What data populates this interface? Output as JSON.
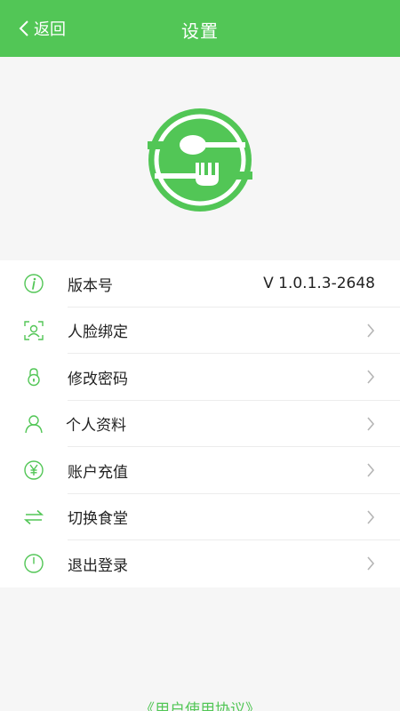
{
  "header": {
    "back_label": "返回",
    "title": "设置"
  },
  "colors": {
    "accent": "#52c656"
  },
  "menu": {
    "items": [
      {
        "label": "版本号",
        "value": "V 1.0.1.3-2648",
        "icon": "info-icon"
      },
      {
        "label": "人脸绑定",
        "icon": "face-scan-icon"
      },
      {
        "label": "修改密码",
        "icon": "lock-icon"
      },
      {
        "label": "个人资料",
        "icon": "user-icon"
      },
      {
        "label": "账户充值",
        "icon": "yen-icon"
      },
      {
        "label": "切换食堂",
        "icon": "switch-arrows-icon"
      },
      {
        "label": "退出登录",
        "icon": "power-icon"
      }
    ]
  },
  "footer": {
    "agreement": "《用户使用协议》"
  }
}
